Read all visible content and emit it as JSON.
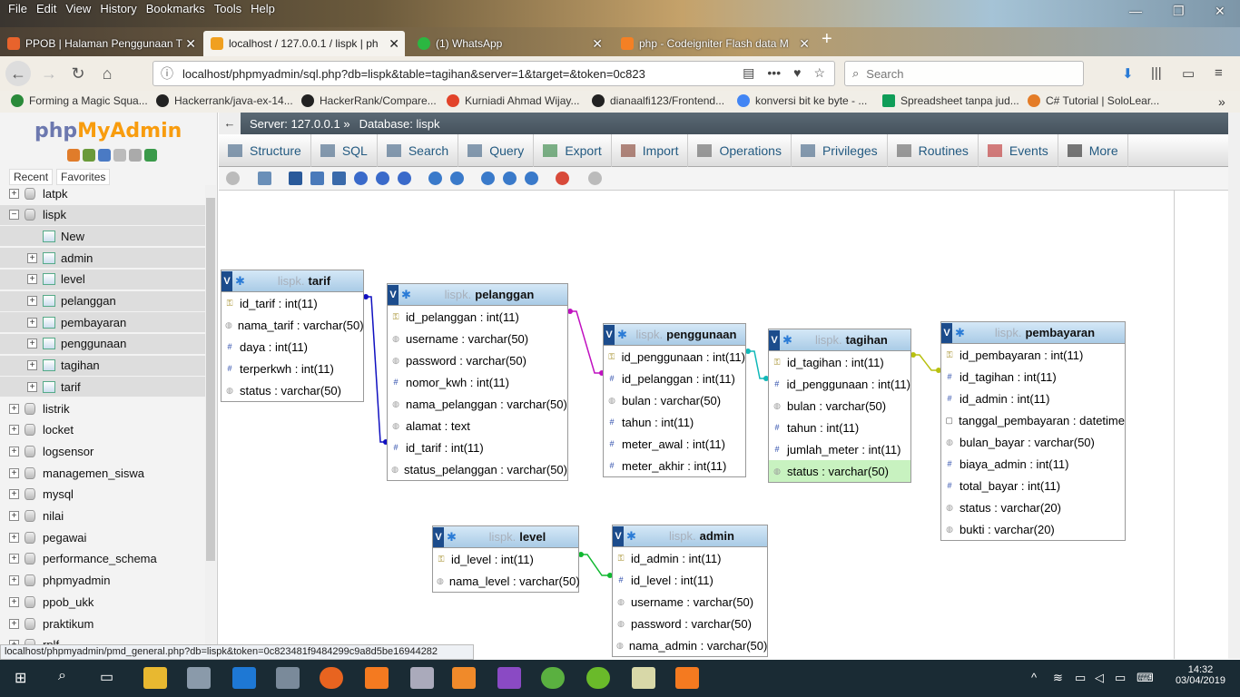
{
  "menu": [
    "File",
    "Edit",
    "View",
    "History",
    "Bookmarks",
    "Tools",
    "Help"
  ],
  "tabs": [
    {
      "label": "PPOB | Halaman Penggunaan T",
      "color": "#e8632c"
    },
    {
      "label": "localhost / 127.0.0.1 / lispk | ph",
      "color": "#f0a020",
      "active": true
    },
    {
      "label": "(1) WhatsApp",
      "color": "#2bb741"
    },
    {
      "label": "php - Codeigniter Flash data M",
      "color": "#f48024"
    }
  ],
  "url": "localhost/phpmyadmin/sql.php?db=lispk&table=tagihan&server=1&target=&token=0c823",
  "search_placeholder": "Search",
  "bookmarks": [
    "Forming a Magic Squa...",
    "Hackerrank/java-ex-14...",
    "HackerRank/Compare...",
    "Kurniadi Ahmad Wijay...",
    "dianaalfi123/Frontend...",
    "konversi bit ke byte - ...",
    "Spreadsheet tanpa jud...",
    "C# Tutorial | SoloLear..."
  ],
  "sidebar": {
    "logo_php": "php",
    "logo_admin": "MyAdmin",
    "recent": "Recent",
    "favorites": "Favorites",
    "databases": [
      {
        "name": "latpk",
        "level": 0
      },
      {
        "name": "lispk",
        "level": 0,
        "expanded": true
      },
      {
        "name": "New",
        "level": 1
      },
      {
        "name": "admin",
        "level": 1
      },
      {
        "name": "level",
        "level": 1
      },
      {
        "name": "pelanggan",
        "level": 1
      },
      {
        "name": "pembayaran",
        "level": 1
      },
      {
        "name": "penggunaan",
        "level": 1
      },
      {
        "name": "tagihan",
        "level": 1
      },
      {
        "name": "tarif",
        "level": 1
      },
      {
        "name": "listrik",
        "level": 0
      },
      {
        "name": "locket",
        "level": 0
      },
      {
        "name": "logsensor",
        "level": 0
      },
      {
        "name": "managemen_siswa",
        "level": 0
      },
      {
        "name": "mysql",
        "level": 0
      },
      {
        "name": "nilai",
        "level": 0
      },
      {
        "name": "pegawai",
        "level": 0
      },
      {
        "name": "performance_schema",
        "level": 0
      },
      {
        "name": "phpmyadmin",
        "level": 0
      },
      {
        "name": "ppob_ukk",
        "level": 0
      },
      {
        "name": "praktikum",
        "level": 0
      },
      {
        "name": "rplf",
        "level": 0
      }
    ]
  },
  "breadcrumb": {
    "server": "Server: 127.0.0.1 »",
    "database": "Database: lispk"
  },
  "main_tabs": [
    "Structure",
    "SQL",
    "Search",
    "Query",
    "Export",
    "Import",
    "Operations",
    "Privileges",
    "Routines",
    "Events",
    "More"
  ],
  "designer_tables": [
    {
      "db": "lispk.",
      "name": "tarif",
      "columns": [
        {
          "t": "id_tarif : int(11)",
          "k": "pk"
        },
        {
          "t": "nama_tarif : varchar(50)",
          "k": "s"
        },
        {
          "t": "daya : int(11)",
          "k": "n"
        },
        {
          "t": "terperkwh : int(11)",
          "k": "n"
        },
        {
          "t": "status : varchar(50)",
          "k": "s"
        }
      ]
    },
    {
      "db": "lispk.",
      "name": "pelanggan",
      "columns": [
        {
          "t": "id_pelanggan : int(11)",
          "k": "pk"
        },
        {
          "t": "username : varchar(50)",
          "k": "s"
        },
        {
          "t": "password : varchar(50)",
          "k": "s"
        },
        {
          "t": "nomor_kwh : int(11)",
          "k": "n"
        },
        {
          "t": "nama_pelanggan : varchar(50)",
          "k": "s"
        },
        {
          "t": "alamat : text",
          "k": "s"
        },
        {
          "t": "id_tarif : int(11)",
          "k": "n"
        },
        {
          "t": "status_pelanggan : varchar(50)",
          "k": "s"
        }
      ]
    },
    {
      "db": "lispk.",
      "name": "penggunaan",
      "columns": [
        {
          "t": "id_penggunaan : int(11)",
          "k": "pk"
        },
        {
          "t": "id_pelanggan : int(11)",
          "k": "n"
        },
        {
          "t": "bulan : varchar(50)",
          "k": "s"
        },
        {
          "t": "tahun : int(11)",
          "k": "n"
        },
        {
          "t": "meter_awal : int(11)",
          "k": "n"
        },
        {
          "t": "meter_akhir : int(11)",
          "k": "n"
        }
      ]
    },
    {
      "db": "lispk.",
      "name": "tagihan",
      "columns": [
        {
          "t": "id_tagihan : int(11)",
          "k": "pk"
        },
        {
          "t": "id_penggunaan : int(11)",
          "k": "n"
        },
        {
          "t": "bulan : varchar(50)",
          "k": "s"
        },
        {
          "t": "tahun : int(11)",
          "k": "n"
        },
        {
          "t": "jumlah_meter : int(11)",
          "k": "n"
        },
        {
          "t": "status : varchar(50)",
          "k": "s",
          "hl": true
        }
      ]
    },
    {
      "db": "lispk.",
      "name": "pembayaran",
      "columns": [
        {
          "t": "id_pembayaran : int(11)",
          "k": "pk"
        },
        {
          "t": "id_tagihan : int(11)",
          "k": "n"
        },
        {
          "t": "id_admin : int(11)",
          "k": "n"
        },
        {
          "t": "tanggal_pembayaran : datetime",
          "k": "d"
        },
        {
          "t": "bulan_bayar : varchar(50)",
          "k": "s"
        },
        {
          "t": "biaya_admin : int(11)",
          "k": "n"
        },
        {
          "t": "total_bayar : int(11)",
          "k": "n"
        },
        {
          "t": "status : varchar(20)",
          "k": "s"
        },
        {
          "t": "bukti : varchar(20)",
          "k": "s"
        }
      ]
    },
    {
      "db": "lispk.",
      "name": "level",
      "columns": [
        {
          "t": "id_level : int(11)",
          "k": "pk"
        },
        {
          "t": "nama_level : varchar(50)",
          "k": "s"
        }
      ]
    },
    {
      "db": "lispk.",
      "name": "admin",
      "columns": [
        {
          "t": "id_admin : int(11)",
          "k": "pk"
        },
        {
          "t": "id_level : int(11)",
          "k": "n"
        },
        {
          "t": "username : varchar(50)",
          "k": "s"
        },
        {
          "t": "password : varchar(50)",
          "k": "s"
        },
        {
          "t": "nama_admin : varchar(50)",
          "k": "s"
        }
      ]
    }
  ],
  "status_url": "localhost/phpmyadmin/pmd_general.php?db=lispk&token=0c823481f9484299c9a8d5be16944282",
  "clock": {
    "time": "14:32",
    "date": "03/04/2019"
  },
  "colors": {
    "pma_blue": "#6c78af",
    "pma_orange": "#f89c0e",
    "taskbar": "#1a2b34",
    "highlight_row": "#c8f2c0"
  }
}
